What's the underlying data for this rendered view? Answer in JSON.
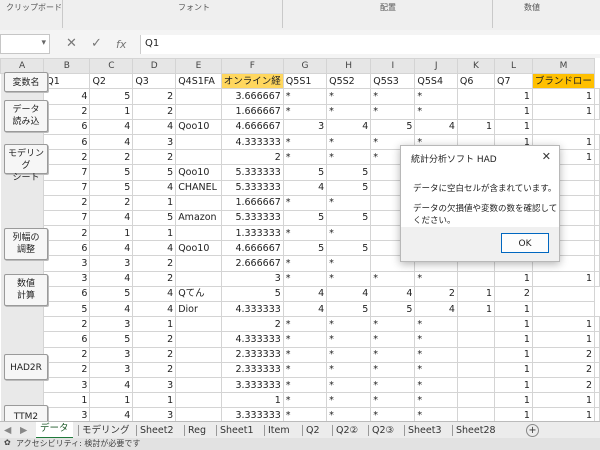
{
  "ribbon": {
    "groups": [
      "クリップボード",
      "フォント",
      "配置",
      "数値"
    ]
  },
  "formula_bar": {
    "name_box": "",
    "fx": "fx",
    "content": "Q1"
  },
  "columns": [
    "A",
    "B",
    "C",
    "D",
    "E",
    "F",
    "G",
    "H",
    "I",
    "J",
    "K",
    "L",
    "M"
  ],
  "sidebar_buttons": {
    "var_name": "変数名",
    "load_data": [
      "データ",
      "読み込"
    ],
    "modeling": [
      "モデリング",
      "シート"
    ],
    "col_width": [
      "列幅の",
      "調整"
    ],
    "calc": [
      "数値",
      "計算"
    ],
    "had2r": "HAD2R",
    "ttm2": "TTM2"
  },
  "header_row": [
    "Q1",
    "Q2",
    "Q3",
    "Q4S1FA",
    "オンライン経",
    "Q5S1",
    "Q5S2",
    "Q5S3",
    "Q5S4",
    "Q6",
    "Q7",
    "ブランドロー"
  ],
  "rows": [
    [
      "4",
      "5",
      "2",
      "",
      "3.666667",
      "*",
      "*",
      "*",
      "*",
      "",
      "1",
      "1",
      ""
    ],
    [
      "2",
      "1",
      "2",
      "",
      "1.666667",
      "*",
      "*",
      "*",
      "*",
      "",
      "1",
      "1",
      ""
    ],
    [
      "6",
      "4",
      "4",
      "Qoo10",
      "4.666667",
      "3",
      "4",
      "5",
      "4",
      "1",
      "1",
      ""
    ],
    [
      "6",
      "4",
      "3",
      "",
      "4.333333",
      "*",
      "*",
      "*",
      "*",
      "",
      "1",
      "1",
      ""
    ],
    [
      "2",
      "2",
      "2",
      "",
      "2",
      "*",
      "*",
      "*",
      "*",
      "",
      "1",
      "1",
      ""
    ],
    [
      "7",
      "5",
      "5",
      "Qoo10",
      "5.333333",
      "5",
      "5",
      "",
      "",
      "",
      "",
      "",
      ""
    ],
    [
      "7",
      "5",
      "4",
      "CHANEL",
      "5.333333",
      "4",
      "5",
      "",
      "",
      "",
      "",
      "",
      ""
    ],
    [
      "2",
      "2",
      "1",
      "",
      "1.666667",
      "*",
      "*",
      "",
      "",
      "",
      "",
      "",
      ""
    ],
    [
      "7",
      "4",
      "5",
      "Amazon",
      "5.333333",
      "5",
      "5",
      "",
      "",
      "",
      "",
      "",
      ""
    ],
    [
      "2",
      "1",
      "1",
      "",
      "1.333333",
      "*",
      "*",
      "",
      "",
      "",
      "",
      "",
      ""
    ],
    [
      "6",
      "4",
      "4",
      "Qoo10",
      "4.666667",
      "5",
      "5",
      "",
      "",
      "",
      "",
      "",
      ""
    ],
    [
      "3",
      "3",
      "2",
      "",
      "2.666667",
      "*",
      "*",
      "",
      "",
      "",
      "",
      "",
      ""
    ],
    [
      "3",
      "4",
      "2",
      "",
      "3",
      "*",
      "*",
      "*",
      "*",
      "",
      "1",
      "1",
      ""
    ],
    [
      "6",
      "5",
      "4",
      "Qてん",
      "5",
      "4",
      "4",
      "4",
      "2",
      "1",
      "2",
      ""
    ],
    [
      "5",
      "4",
      "4",
      "Dior",
      "4.333333",
      "4",
      "5",
      "5",
      "4",
      "1",
      "1",
      ""
    ],
    [
      "2",
      "3",
      "1",
      "",
      "2",
      "*",
      "*",
      "*",
      "*",
      "",
      "1",
      "1",
      ""
    ],
    [
      "6",
      "5",
      "2",
      "",
      "4.333333",
      "*",
      "*",
      "*",
      "*",
      "",
      "1",
      "1",
      ""
    ],
    [
      "2",
      "3",
      "2",
      "",
      "2.333333",
      "*",
      "*",
      "*",
      "*",
      "",
      "1",
      "2",
      ""
    ],
    [
      "2",
      "3",
      "2",
      "",
      "2.333333",
      "*",
      "*",
      "*",
      "*",
      "",
      "1",
      "2",
      ""
    ],
    [
      "3",
      "4",
      "3",
      "",
      "3.333333",
      "*",
      "*",
      "*",
      "*",
      "",
      "1",
      "2",
      ""
    ],
    [
      "1",
      "1",
      "1",
      "",
      "1",
      "*",
      "*",
      "*",
      "*",
      "",
      "1",
      "1",
      ""
    ],
    [
      "3",
      "4",
      "3",
      "",
      "3.333333",
      "*",
      "*",
      "*",
      "*",
      "",
      "1",
      "1",
      ""
    ],
    [
      "2",
      "5",
      "1",
      "",
      "2.666667",
      "*",
      "*",
      "*",
      "*",
      "",
      "1",
      "2",
      ""
    ],
    [
      "3",
      "2",
      "1",
      "",
      "2",
      "*",
      "*",
      "*",
      "*",
      "",
      "1",
      "4",
      ""
    ],
    [
      "2",
      "4",
      "1",
      "",
      "4.666667",
      "*",
      "*",
      "*",
      "*",
      "",
      "1",
      "1",
      ""
    ]
  ],
  "dialog": {
    "title": "統計分析ソフト HAD",
    "close": "✕",
    "message1": "データに空白セルが含まれています。",
    "message2": "データの欠損値や変数の数を確認してください。",
    "ok": "OK"
  },
  "tabs": [
    "データ",
    "モデリング",
    "Sheet2",
    "Reg",
    "Sheet1",
    "Item",
    "Q2",
    "Q2②",
    "Q2③",
    "Sheet3",
    "Sheet28"
  ],
  "add_tab": "+",
  "status": "アクセシビリティ: 検討が必要です"
}
